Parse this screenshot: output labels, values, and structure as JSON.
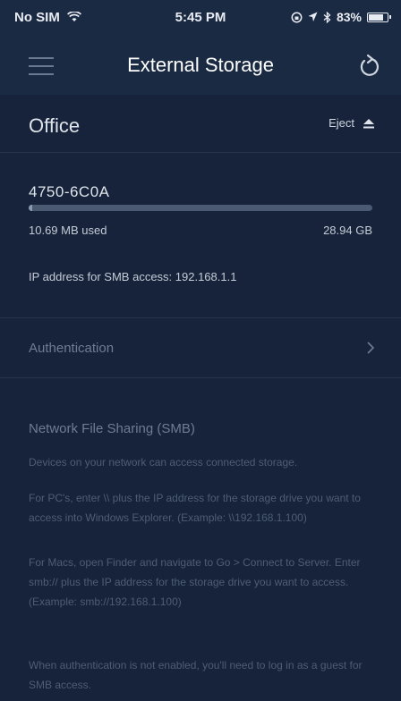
{
  "status_bar": {
    "carrier": "No SIM",
    "time": "5:45 PM",
    "battery": "83%",
    "battery_level": 0.83
  },
  "nav": {
    "title": "External Storage",
    "menu_icon": "hamburger-icon",
    "refresh_icon": "refresh-icon"
  },
  "office": {
    "title": "Office",
    "eject_label": "Eject"
  },
  "storage": {
    "name": "4750-6C0A",
    "used": "10.69 MB used",
    "total": "28.94 GB",
    "used_fraction": 0.01,
    "ip_text": "IP address for SMB access: 192.168.1.1"
  },
  "authentication": {
    "label": "Authentication"
  },
  "smb": {
    "title": "Network File Sharing (SMB)",
    "paragraphs": [
      "Devices on your network can access connected storage.",
      "For PC's, enter \\\\ plus the IP address for the storage drive you want to access into Windows Explorer. (Example: \\\\192.168.1.100)",
      "For Macs, open Finder and navigate to Go > Connect to Server. Enter smb:// plus the IP address for the storage drive you want to access. (Example: smb://192.168.1.100)",
      "When authentication is not enabled, you'll need to log in as a guest for SMB access."
    ]
  }
}
